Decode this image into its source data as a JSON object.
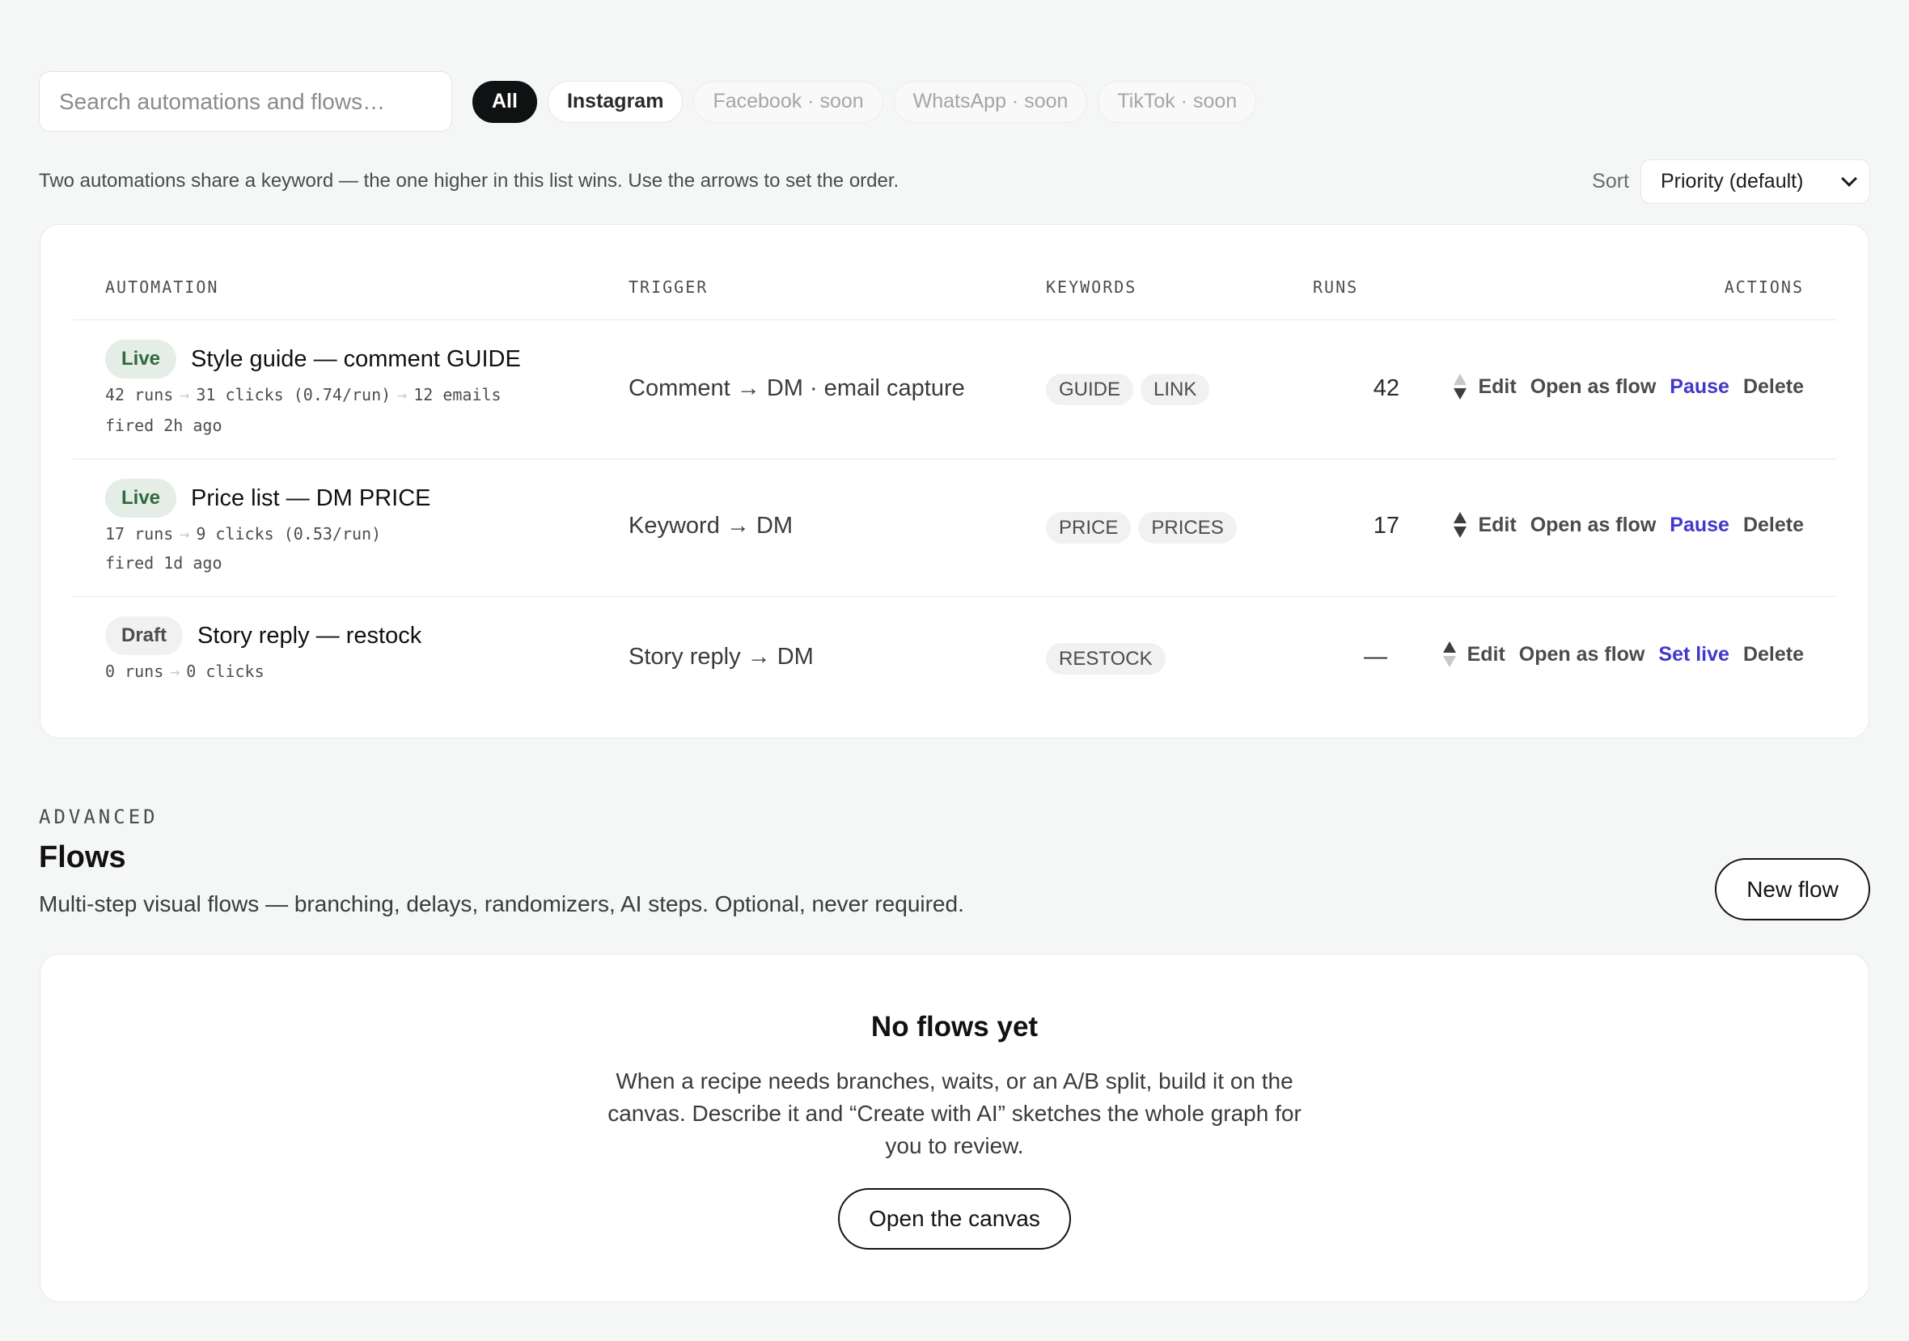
{
  "search": {
    "placeholder": "Search automations and flows…"
  },
  "filters": [
    {
      "label": "All",
      "state": "active"
    },
    {
      "label": "Instagram",
      "state": "enabled"
    },
    {
      "label": "Facebook · soon",
      "state": "disabled"
    },
    {
      "label": "WhatsApp · soon",
      "state": "disabled"
    },
    {
      "label": "TikTok · soon",
      "state": "disabled"
    }
  ],
  "hint": "Two automations share a keyword — the one higher in this list wins. Use the arrows to set the order.",
  "sort": {
    "label": "Sort",
    "value": "Priority (default)"
  },
  "table": {
    "columns": {
      "automation": "AUTOMATION",
      "trigger": "TRIGGER",
      "keywords": "KEYWORDS",
      "runs": "RUNS",
      "actions": "ACTIONS"
    },
    "rows": [
      {
        "status": "Live",
        "title": "Style guide — comment GUIDE",
        "stats": [
          "42 runs",
          "31 clicks (0.74/run)",
          "12 emails"
        ],
        "fired": "fired 2h ago",
        "trigger": "Comment → DM · email capture",
        "keywords": [
          "GUIDE",
          "LINK"
        ],
        "runs": "42",
        "actions": {
          "edit": "Edit",
          "open": "Open as flow",
          "toggle": "Pause",
          "delete": "Delete"
        }
      },
      {
        "status": "Live",
        "title": "Price list — DM PRICE",
        "stats": [
          "17 runs",
          "9 clicks (0.53/run)"
        ],
        "fired": "fired 1d ago",
        "trigger": "Keyword → DM",
        "keywords": [
          "PRICE",
          "PRICES"
        ],
        "runs": "17",
        "actions": {
          "edit": "Edit",
          "open": "Open as flow",
          "toggle": "Pause",
          "delete": "Delete"
        }
      },
      {
        "status": "Draft",
        "title": "Story reply — restock",
        "stats": [
          "0 runs",
          "0 clicks"
        ],
        "fired": "",
        "trigger": "Story reply → DM",
        "keywords": [
          "RESTOCK"
        ],
        "runs": "—",
        "actions": {
          "edit": "Edit",
          "open": "Open as flow",
          "toggle": "Set live",
          "delete": "Delete"
        }
      }
    ]
  },
  "advanced": {
    "eyebrow": "ADVANCED",
    "title": "Flows",
    "subtitle": "Multi-step visual flows — branching, delays, randomizers, AI steps. Optional, never required.",
    "new_button": "New flow",
    "empty": {
      "title": "No flows yet",
      "body": "When a recipe needs branches, waits, or an A/B split, build it on the canvas. Describe it and “Create with AI” sketches the whole graph for you to review.",
      "cta": "Open the canvas"
    }
  },
  "colors": {
    "accent": "#4338ca",
    "live_bg": "#e4ede6",
    "live_text": "#2f6a3e",
    "chip_active": "#0f1112"
  }
}
